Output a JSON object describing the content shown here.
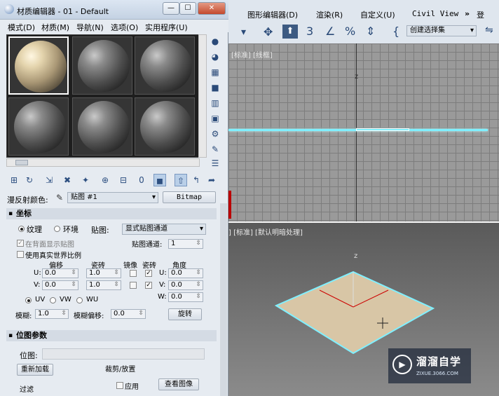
{
  "main_window": {
    "menu": [
      "图形编辑器(D)",
      "渲染(R)",
      "自定义(U)",
      "Civil View"
    ],
    "overflow": "»",
    "right_label": "登",
    "selection_set_dropdown": "创建选择集",
    "top_viewport_label": "[标准] [线框]",
    "bottom_viewport_label": "] [标准] [默认明暗处理]",
    "axis_z": "z"
  },
  "material_editor": {
    "title": "材质编辑器 - 01 - Default",
    "window_buttons": {
      "minimize": "—",
      "maximize": "☐",
      "close": "✕"
    },
    "menu": [
      "模式(D)",
      "材质(M)",
      "导航(N)",
      "选项(O)",
      "实用程序(U)"
    ],
    "diffuse_label": "漫反射颜色:",
    "map_dropdown": "贴图 #1",
    "map_type_button": "Bitmap",
    "coordinates": {
      "header": "坐标",
      "texture_label": "纹理",
      "environ_label": "环境",
      "mapping_label": "贴图:",
      "mapping_dropdown": "显式贴图通道",
      "show_back_label": "在背面显示贴图",
      "map_channel_label": "贴图通道:",
      "map_channel_value": "1",
      "real_world_label": "使用真实世界比例",
      "offset_label": "偏移",
      "tiling_label": "瓷砖",
      "mirror_label": "镜像",
      "tile_label": "瓷砖",
      "angle_label": "角度",
      "u_label": "U:",
      "v_label": "V:",
      "w_label": "W:",
      "offset_u": "0.0",
      "offset_v": "0.0",
      "tiling_u": "1.0",
      "tiling_v": "1.0",
      "angle_u": "0.0",
      "angle_v": "0.0",
      "angle_w": "0.0",
      "uv_label": "UV",
      "vw_label": "VW",
      "wu_label": "WU",
      "blur_label": "模糊:",
      "blur_value": "1.0",
      "blur_offset_label": "模糊偏移:",
      "blur_offset_value": "0.0",
      "rotate_button": "旋转"
    },
    "bitmap_params": {
      "header": "位图参数",
      "bitmap_label": "位图:",
      "reload_button": "重新加载",
      "crop_label": "裁剪/放置",
      "apply_label": "应用",
      "view_image_button": "查看图像",
      "filter_label": "过滤"
    }
  },
  "watermark": {
    "title": "溜溜自学",
    "subtitle": "ZIXUE.3066.COM"
  }
}
